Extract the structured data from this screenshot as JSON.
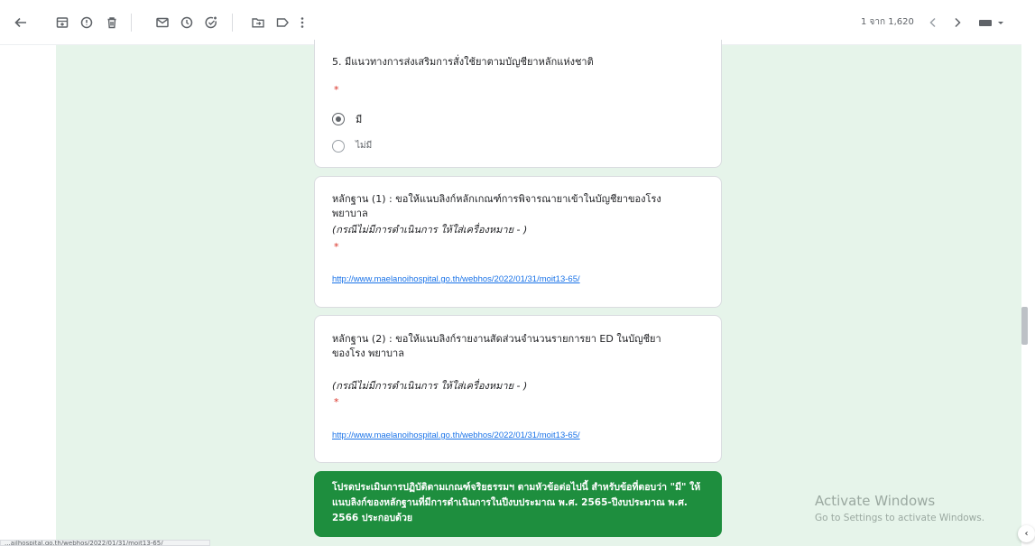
{
  "toolbar": {
    "page_count": "1 จาก 1,620",
    "buttons": [
      "back-icon",
      "archive-icon",
      "report-spam-icon",
      "delete-icon",
      "mark-unread-icon",
      "snooze-icon",
      "add-task-icon",
      "move-to-icon",
      "label-icon",
      "more-icon",
      "prev-icon",
      "next-icon",
      "keyboard-icon"
    ]
  },
  "form": {
    "q5": {
      "title": "5. มีแนวทางการส่งเสริมการสั่งใช้ยาตามบัญชียาหลักแห่งชาติ",
      "required_mark": "*",
      "options": [
        {
          "label": "มี",
          "selected": true
        },
        {
          "label": "ไม่มี",
          "selected": false
        }
      ]
    },
    "evidence1": {
      "title": "หลักฐาน (1) : ขอให้แนบลิงก์หลักเกณฑ์การพิจารณายาเข้าในบัญชียาของโรงพยาบาล",
      "note": "(กรณีไม่มีการดำเนินการ ให้ใส่เครื่องหมาย - )",
      "required_mark": "*",
      "answer": "http://www.maelanoihospital.go.th/webhos/2022/01/31/moit13-65/"
    },
    "evidence2": {
      "title": "หลักฐาน (2) : ขอให้แนบลิงก์รายงานสัดส่วนจำนวนรายการยา ED ในบัญชียาของโรง พยาบาล",
      "note": "(กรณีไม่มีการดำเนินการ ให้ใส่เครื่องหมาย - )",
      "required_mark": "*",
      "answer": "http://www.maelanoihospital.go.th/webhos/2022/01/31/moit13-65/"
    },
    "section_banner": "โปรดประเมินการปฏิบัติตามเกณฑ์จริยธรรมฯ ตามหัวข้อต่อไปนี้ สำหรับข้อที่ตอบว่า \"มี\" ให้แนบลิงก์ของหลักฐานที่มีการดำเนินการในปีงบประมาณ พ.ศ. 2565-ปีงบประมาณ พ.ศ. 2566 ประกอบด้วย"
  },
  "watermark": {
    "title": "Activate Windows",
    "subtitle": "Go to Settings to activate Windows."
  },
  "status_bar": {
    "url": "...ailhospital.go.th/webhos/2022/01/31/moit13-65/"
  },
  "colors": {
    "mail_background": "#e6f4ea",
    "banner": "#1e8e3e",
    "link": "#1a73e8",
    "required": "#d93025"
  }
}
